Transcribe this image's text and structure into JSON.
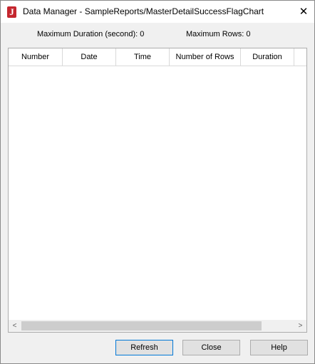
{
  "window": {
    "title": "Data Manager - SampleReports/MasterDetailSuccessFlagChart",
    "app_icon_letter": "J",
    "close_glyph": "✕"
  },
  "info": {
    "max_duration": "Maximum Duration (second): 0",
    "max_rows": "Maximum Rows: 0"
  },
  "table": {
    "columns": [
      "Number",
      "Date",
      "Time",
      "Number of Rows",
      "Duration"
    ],
    "rows": []
  },
  "scrollbar": {
    "left_arrow": "<",
    "right_arrow": ">"
  },
  "buttons": {
    "refresh": "Refresh",
    "close": "Close",
    "help": "Help"
  },
  "colors": {
    "app_icon": "#c4262e",
    "default_button_border": "#0078d7"
  }
}
